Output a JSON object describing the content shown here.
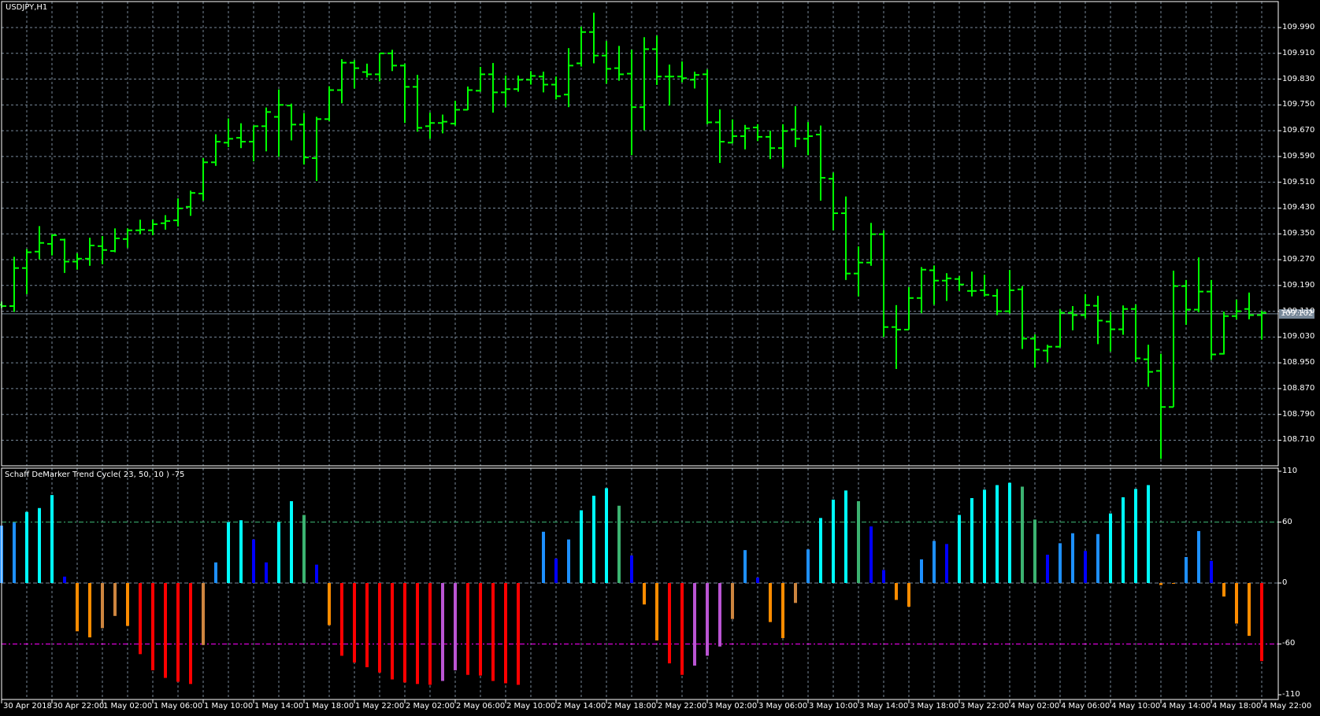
{
  "chart": {
    "symbol_label": "USDJPY,H1",
    "indicator_label": "Schaff DeMarker Trend Cycle( 23, 50, 10 ) -75",
    "current_price": "109.102",
    "colors": {
      "bars": "#00FF00",
      "grid": "#778899",
      "background": "#000000",
      "upper_level": "#3CB371",
      "lower_level": "#FF00FF"
    }
  },
  "chart_data": [
    {
      "type": "ohlc",
      "title": "USDJPY,H1",
      "price_ticks": [
        "109.990",
        "109.910",
        "109.830",
        "109.750",
        "109.670",
        "109.590",
        "109.510",
        "109.430",
        "109.350",
        "109.270",
        "109.190",
        "109.110",
        "109.030",
        "108.950",
        "108.870",
        "108.790",
        "108.710"
      ],
      "ylim": [
        108.71,
        109.99
      ],
      "time_ticks": [
        "30 Apr 2018",
        "30 Apr 22:00",
        "1 May 02:00",
        "1 May 06:00",
        "1 May 10:00",
        "1 May 14:00",
        "1 May 18:00",
        "1 May 22:00",
        "2 May 02:00",
        "2 May 06:00",
        "2 May 10:00",
        "2 May 14:00",
        "2 May 18:00",
        "2 May 22:00",
        "3 May 02:00",
        "3 May 06:00",
        "3 May 10:00",
        "3 May 14:00",
        "3 May 18:00",
        "3 May 22:00",
        "4 May 02:00",
        "4 May 06:00",
        "4 May 10:00",
        "4 May 14:00",
        "4 May 18:00",
        "4 May 22:00"
      ],
      "grid": true,
      "ohlc": [
        [
          109.13,
          109.14,
          109.12,
          109.126
        ],
        [
          109.126,
          109.279,
          109.108,
          109.244
        ],
        [
          109.244,
          109.303,
          109.163,
          109.293
        ],
        [
          109.295,
          109.374,
          109.271,
          109.322
        ],
        [
          109.319,
          109.349,
          109.283,
          109.346
        ],
        [
          109.332,
          109.335,
          109.229,
          109.264
        ],
        [
          109.264,
          109.29,
          109.239,
          109.273
        ],
        [
          109.273,
          109.338,
          109.251,
          109.314
        ],
        [
          109.312,
          109.343,
          109.256,
          109.3
        ],
        [
          109.297,
          109.367,
          109.293,
          109.336
        ],
        [
          109.334,
          109.367,
          109.307,
          109.361
        ],
        [
          109.361,
          109.394,
          109.349,
          109.363
        ],
        [
          109.361,
          109.394,
          109.346,
          109.38
        ],
        [
          109.383,
          109.408,
          109.363,
          109.39
        ],
        [
          109.392,
          109.46,
          109.373,
          109.429
        ],
        [
          109.434,
          109.484,
          109.406,
          109.477
        ],
        [
          109.475,
          109.585,
          109.453,
          109.572
        ],
        [
          109.572,
          109.659,
          109.561,
          109.636
        ],
        [
          109.633,
          109.708,
          109.619,
          109.645
        ],
        [
          109.648,
          109.693,
          109.616,
          109.636
        ],
        [
          109.636,
          109.686,
          109.575,
          109.684
        ],
        [
          109.684,
          109.742,
          109.606,
          109.728
        ],
        [
          109.713,
          109.798,
          109.589,
          109.75
        ],
        [
          109.748,
          109.754,
          109.64,
          109.689
        ],
        [
          109.689,
          109.725,
          109.565,
          109.587
        ],
        [
          109.585,
          109.713,
          109.514,
          109.706
        ],
        [
          109.706,
          109.808,
          109.7,
          109.796
        ],
        [
          109.796,
          109.892,
          109.755,
          109.881
        ],
        [
          109.881,
          109.889,
          109.801,
          109.864
        ],
        [
          109.852,
          109.878,
          109.835,
          109.845
        ],
        [
          109.845,
          109.911,
          109.823,
          109.91
        ],
        [
          109.91,
          109.921,
          109.855,
          109.872
        ],
        [
          109.872,
          109.878,
          109.694,
          109.806
        ],
        [
          109.806,
          109.843,
          109.667,
          109.679
        ],
        [
          109.684,
          109.726,
          109.645,
          109.694
        ],
        [
          109.694,
          109.72,
          109.662,
          109.698
        ],
        [
          109.692,
          109.763,
          109.686,
          109.735
        ],
        [
          109.735,
          109.807,
          109.734,
          109.796
        ],
        [
          109.794,
          109.868,
          109.791,
          109.845
        ],
        [
          109.845,
          109.88,
          109.726,
          109.789
        ],
        [
          109.789,
          109.841,
          109.743,
          109.799
        ],
        [
          109.799,
          109.841,
          109.791,
          109.828
        ],
        [
          109.828,
          109.855,
          109.813,
          109.84
        ],
        [
          109.838,
          109.853,
          109.789,
          109.813
        ],
        [
          109.813,
          109.838,
          109.767,
          109.777
        ],
        [
          109.782,
          109.926,
          109.743,
          109.872
        ],
        [
          109.879,
          109.993,
          109.869,
          109.976
        ],
        [
          109.976,
          110.036,
          109.879,
          109.903
        ],
        [
          109.903,
          109.948,
          109.816,
          109.862
        ],
        [
          109.864,
          109.933,
          109.825,
          109.845
        ],
        [
          109.847,
          109.921,
          109.594,
          109.743
        ],
        [
          109.743,
          109.96,
          109.671,
          109.923
        ],
        [
          109.923,
          109.965,
          109.812,
          109.838
        ],
        [
          109.838,
          109.875,
          109.748,
          109.838
        ],
        [
          109.838,
          109.885,
          109.82,
          109.833
        ],
        [
          109.828,
          109.853,
          109.801,
          109.843
        ],
        [
          109.845,
          109.86,
          109.69,
          109.696
        ],
        [
          109.696,
          109.736,
          109.57,
          109.636
        ],
        [
          109.633,
          109.705,
          109.631,
          109.653
        ],
        [
          109.653,
          109.688,
          109.612,
          109.677
        ],
        [
          109.68,
          109.69,
          109.638,
          109.651
        ],
        [
          109.651,
          109.67,
          109.582,
          109.616
        ],
        [
          109.616,
          109.69,
          109.555,
          109.669
        ],
        [
          109.674,
          109.746,
          109.619,
          109.645
        ],
        [
          109.645,
          109.697,
          109.594,
          109.653
        ],
        [
          109.658,
          109.686,
          109.453,
          109.524
        ],
        [
          109.521,
          109.54,
          109.361,
          109.414
        ],
        [
          109.414,
          109.466,
          109.207,
          109.227
        ],
        [
          109.227,
          109.311,
          109.156,
          109.261
        ],
        [
          109.261,
          109.384,
          109.251,
          109.349
        ],
        [
          109.349,
          109.361,
          109.03,
          109.061
        ],
        [
          109.061,
          109.129,
          108.931,
          109.053
        ],
        [
          109.053,
          109.185,
          109.053,
          109.151
        ],
        [
          109.151,
          109.247,
          109.104,
          109.239
        ],
        [
          109.237,
          109.252,
          109.13,
          109.205
        ],
        [
          109.205,
          109.228,
          109.142,
          109.212
        ],
        [
          109.21,
          109.219,
          109.173,
          109.193
        ],
        [
          109.173,
          109.233,
          109.156,
          109.173
        ],
        [
          109.175,
          109.223,
          109.156,
          109.161
        ],
        [
          109.158,
          109.179,
          109.098,
          109.11
        ],
        [
          109.11,
          109.238,
          109.103,
          109.175
        ],
        [
          109.178,
          109.188,
          108.993,
          109.025
        ],
        [
          109.025,
          109.038,
          108.935,
          108.991
        ],
        [
          108.988,
          109.006,
          108.952,
          109.0
        ],
        [
          109.0,
          109.116,
          108.998,
          109.105
        ],
        [
          109.105,
          109.126,
          109.051,
          109.098
        ],
        [
          109.098,
          109.163,
          109.088,
          109.129
        ],
        [
          109.127,
          109.158,
          109.008,
          109.081
        ],
        [
          109.078,
          109.109,
          108.985,
          109.054
        ],
        [
          109.054,
          109.128,
          109.037,
          109.117
        ],
        [
          109.117,
          109.131,
          108.953,
          108.964
        ],
        [
          108.961,
          109.006,
          108.876,
          108.922
        ],
        [
          108.925,
          108.978,
          108.652,
          108.813
        ],
        [
          108.813,
          109.236,
          108.813,
          109.188
        ],
        [
          109.188,
          109.207,
          109.068,
          109.115
        ],
        [
          109.115,
          109.277,
          109.107,
          109.171
        ],
        [
          109.171,
          109.207,
          108.959,
          108.976
        ],
        [
          108.978,
          109.109,
          108.976,
          109.095
        ],
        [
          109.095,
          109.146,
          109.085,
          109.11
        ],
        [
          109.117,
          109.168,
          109.085,
          109.098
        ],
        [
          109.098,
          109.112,
          109.022,
          109.105
        ]
      ]
    },
    {
      "type": "bar",
      "title": "Schaff DeMarker Trend Cycle( 23, 50, 10 ) -75",
      "ylim": [
        -110,
        110
      ],
      "y_ticks": [
        "110",
        "60",
        "0",
        "-60",
        "-110"
      ],
      "levels": [
        60,
        0,
        -60
      ],
      "palette": {
        "C": "#00FFFF",
        "D": "#1E90FF",
        "B": "#0000FF",
        "G": "#3CB371",
        "O": "#FF8C00",
        "P": "#CD853F",
        "R": "#FF0000",
        "M": "#BA55D3"
      },
      "values": [
        56.5,
        59.5,
        70.0,
        73.8,
        86.6,
        6.3,
        -47.5,
        -53.5,
        -44.4,
        -32.4,
        -42.2,
        -70.0,
        -85.9,
        -93.4,
        -97.2,
        -99.4,
        -61.0,
        20.3,
        60.0,
        61.8,
        42.9,
        20.3,
        60.0,
        80.6,
        67.0,
        18.1,
        -41.4,
        -71.6,
        -78.3,
        -82.9,
        -88.1,
        -94.9,
        -97.9,
        -99.4,
        -100.2,
        -96.4,
        -85.9,
        -90.4,
        -91.1,
        -96.4,
        -98.7,
        -100.2,
        0,
        50.5,
        24.1,
        42.9,
        71.6,
        85.9,
        93.4,
        76.1,
        27.1,
        -21.1,
        -56.5,
        -79.1,
        -90.4,
        -81.3,
        -71.6,
        -62.5,
        -35.4,
        32.4,
        5.3,
        -38.4,
        -54.2,
        -19.6,
        33.1,
        64.0,
        82.1,
        91.1,
        80.6,
        55.7,
        12.8,
        -16.6,
        -23.3,
        23.3,
        41.4,
        38.4,
        67.0,
        83.6,
        91.9,
        96.4,
        98.7,
        94.9,
        62.5,
        27.9,
        39.2,
        49.0,
        31.6,
        48.2,
        68.5,
        84.4,
        92.6,
        96.4,
        -2.0,
        -0.5,
        25.6,
        51.2,
        21.8,
        -13.3,
        -39.9,
        -52.0,
        -76.8
      ],
      "colors": "DDCCCBOOPPORRRRRPDCCBBCCGBORRRRRRRRMMRRRRRODBDCCCGBOORRMMMPDBOOPDCCCGBBOODDBCCCCCGGBDDBDCCCCOODDBOOOR"
    }
  ]
}
